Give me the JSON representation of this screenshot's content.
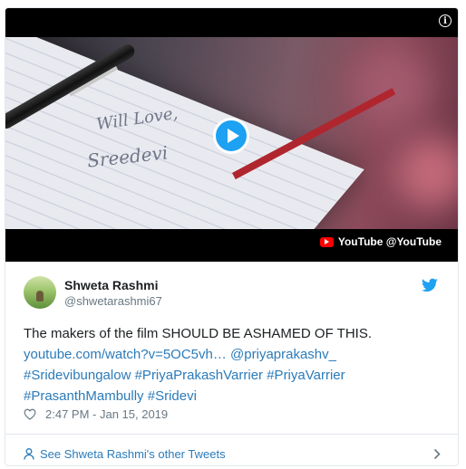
{
  "media": {
    "attribution": "YouTube @YouTube",
    "handwriting_line1": "Will Love,",
    "handwriting_line2": "Sreedevi"
  },
  "author": {
    "display_name": "Shweta Rashmi",
    "screen_name": "@shwetarashmi67"
  },
  "tweet": {
    "text_plain": "The makers of the film SHOULD BE ASHAMED OF THIS.",
    "link_youtube": "youtube.com/watch?v=5OC5vh…",
    "mention": "@priyaprakashv_",
    "hashtag_1": "#Sridevibungalow",
    "hashtag_2": "#PriyaPrakashVarrier",
    "hashtag_3": "#PriyaVarrier",
    "hashtag_4": "#PrasanthMambully",
    "hashtag_5": "#Sridevi"
  },
  "meta": {
    "timestamp": "2:47 PM - Jan 15, 2019"
  },
  "footer": {
    "label": "See Shweta Rashmi's other Tweets"
  },
  "colors": {
    "link": "#2b7bb9",
    "twitter_blue": "#1da1f2",
    "youtube_red": "#ff0000"
  }
}
